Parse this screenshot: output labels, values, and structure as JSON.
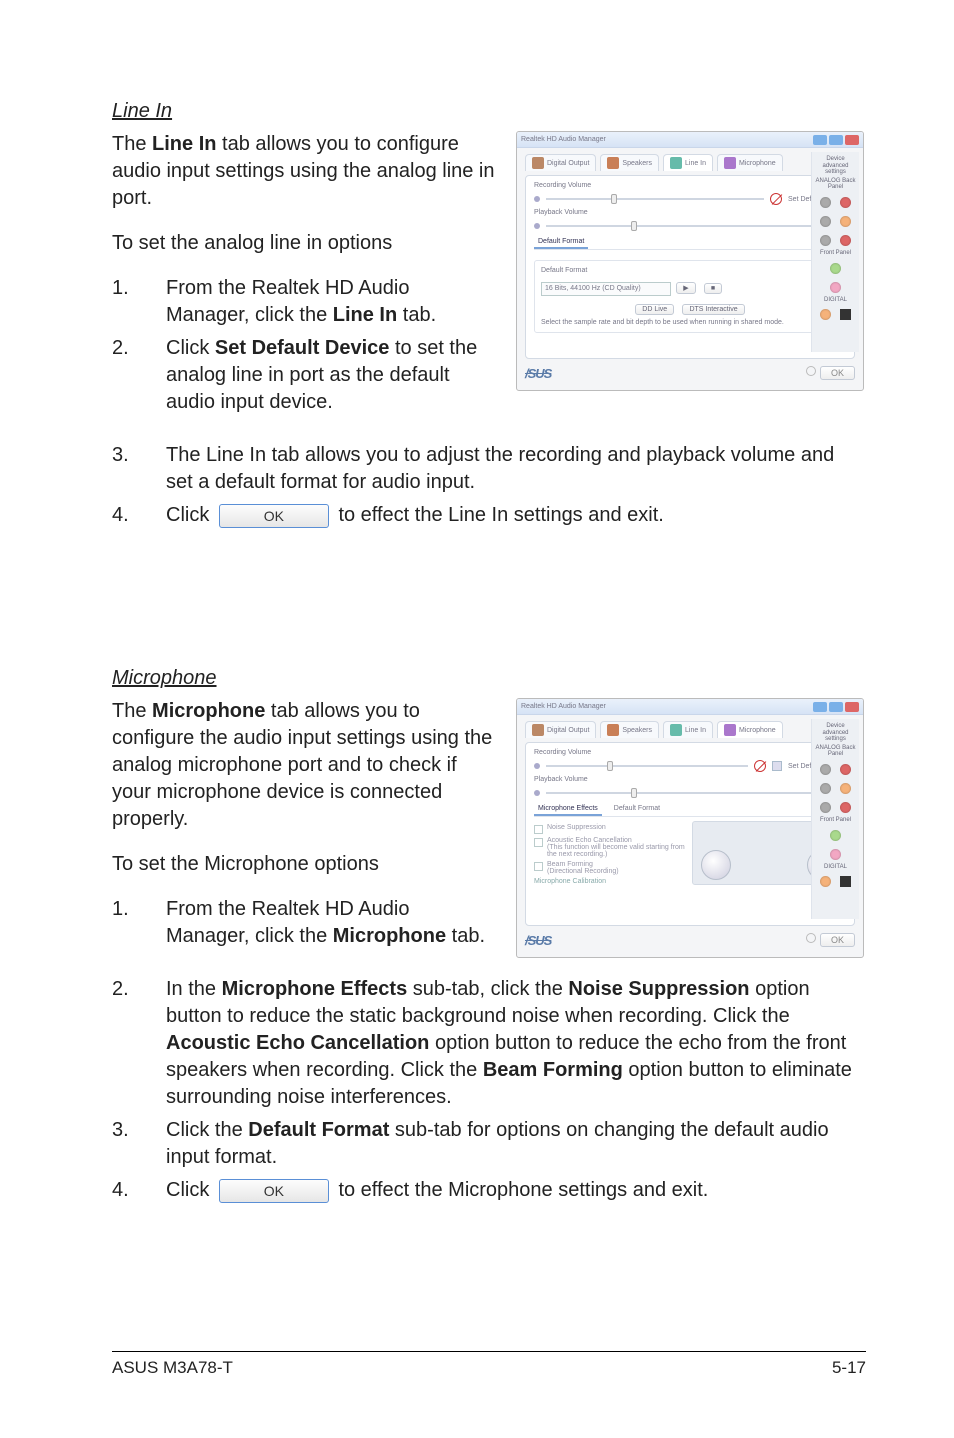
{
  "line_in": {
    "title": "Line In",
    "intro_pre": "The ",
    "intro_bold": "Line In",
    "intro_post": " tab allows you to configure audio input settings using the analog line in port.",
    "to_set": "To set the analog line in options",
    "step1_pre": "From the Realtek HD Audio Manager, click the ",
    "step1_bold": "Line In",
    "step1_post": " tab.",
    "step2_pre": "Click ",
    "step2_bold": "Set Default Device",
    "step2_post": " to set the analog line in port as the default audio input device.",
    "step3": "The Line In tab allows you to adjust the recording and playback volume and set a default format for audio input.",
    "step4_pre": "Click ",
    "step4_post": " to effect the Line In settings and exit.",
    "ok_label": "OK"
  },
  "microphone": {
    "title": "Microphone",
    "intro_pre": "The ",
    "intro_bold": "Microphone",
    "intro_post": " tab allows you to configure the audio input settings using the analog microphone port and to check if your microphone device is connected properly.",
    "to_set": "To set the Microphone options",
    "step1_pre": "From the Realtek HD Audio Manager, click the ",
    "step1_bold": "Microphone",
    "step1_post": " tab.",
    "step2_pre1": "In the ",
    "step2_bold1": "Microphone Effects",
    "step2_mid1": " sub-tab, click the ",
    "step2_bold2": "Noise Suppression",
    "step2_mid2": " option button to reduce the static background noise when recording. Click the ",
    "step2_bold3": "Acoustic Echo Cancellation",
    "step2_mid3": " option button to reduce the echo from the front speakers when recording. Click the ",
    "step2_bold4": "Beam Forming",
    "step2_mid4": " option button to eliminate surrounding noise interferences.",
    "step3_pre": "Click the ",
    "step3_bold": "Default Format",
    "step3_post": " sub-tab for options on changing the default audio input format.",
    "step4_pre": "Click ",
    "step4_post": " to effect the Microphone settings and exit.",
    "ok_label": "OK"
  },
  "screenshot": {
    "window_title": "Realtek HD Audio Manager",
    "tab_digital": "Digital Output",
    "tab_speakers": "Speakers",
    "tab_linein": "Line In",
    "tab_mic": "Microphone",
    "rec_vol": "Recording Volume",
    "play_vol": "Playback Volume",
    "set_default": "Set Default Device",
    "default_format_tab": "Default Format",
    "default_format_label": "Default Format",
    "sample_combo": "16 Bits, 44100 Hz (CD Quality)",
    "btn_play": "▶",
    "btn_stop": "■",
    "hint": "Select the sample rate and bit depth to be used when running in shared mode.",
    "mic_effects_tab": "Microphone Effects",
    "noise_supp": "Noise Suppression",
    "echo_hint": "Acoustic Echo Cancellation\n(This function will become valid starting from the next recording.)",
    "beam_hint": "Beam Forming\n(Directional Recording)",
    "calib": "Microphone Calibration",
    "jack_dev": "Device advanced settings",
    "jack_analog": "ANALOG\nBack Panel",
    "jack_front": "Front Panel",
    "jack_digital": "DIGITAL",
    "ok": "OK",
    "asus": "/SUS"
  },
  "footer": {
    "left": "ASUS M3A78-T",
    "right": "5-17"
  },
  "nums": {
    "n1": "1.",
    "n2": "2.",
    "n3": "3.",
    "n4": "4."
  }
}
